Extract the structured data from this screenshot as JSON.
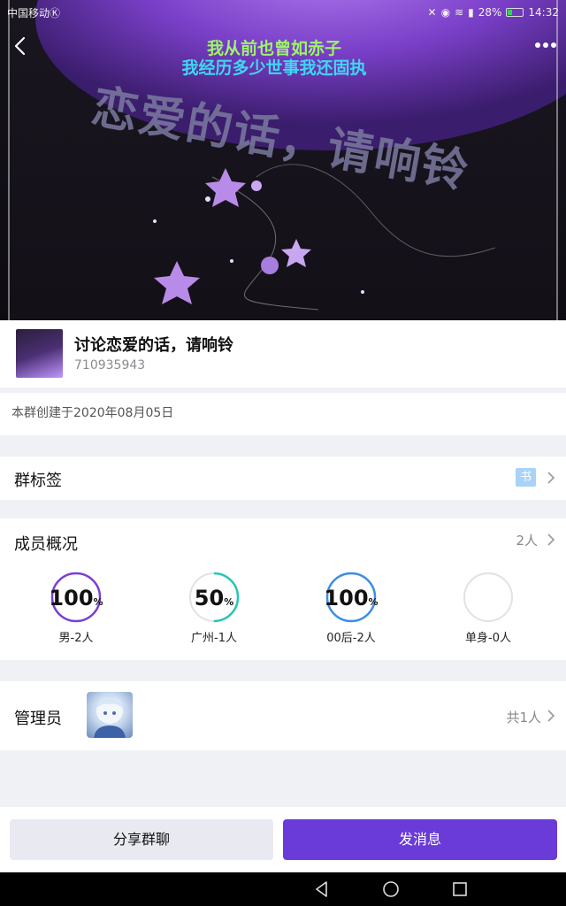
{
  "status_bar": {
    "carrier": "中国移动Ⓚ",
    "battery": "28%",
    "time": "14:32"
  },
  "cover": {
    "lyric_line1": "我从前也曾如赤子",
    "lyric_line2": "我经历多少世事我还固执",
    "art_text": "恋爱的话，请响铃"
  },
  "group": {
    "name": "讨论恋爱的话，请响铃",
    "id": "710935943",
    "created": "本群创建于2020年08月05日"
  },
  "tags": {
    "title": "群标签",
    "badge": "书"
  },
  "members": {
    "title": "成员概况",
    "count": "2人",
    "stats": [
      {
        "value": "100",
        "unit": "%",
        "label": "男-2人",
        "fraction": 1.0,
        "color": "#7b3fd3"
      },
      {
        "value": "50",
        "unit": "%",
        "label": "广州-1人",
        "fraction": 0.5,
        "color": "#2bc4b4"
      },
      {
        "value": "100",
        "unit": "%",
        "label": "00后-2人",
        "fraction": 1.0,
        "color": "#3a8ee6"
      },
      {
        "value": "",
        "unit": "",
        "label": "单身-0人",
        "fraction": 0.0,
        "color": "#dcdcdc"
      }
    ]
  },
  "admins": {
    "title": "管理员",
    "total": "共1人"
  },
  "actions": {
    "share_label": "分享群聊",
    "send_label": "发消息"
  },
  "icons": {
    "back": "back-arrow-icon",
    "more": "more-dots-icon",
    "chevron": "chevron-right-icon"
  }
}
